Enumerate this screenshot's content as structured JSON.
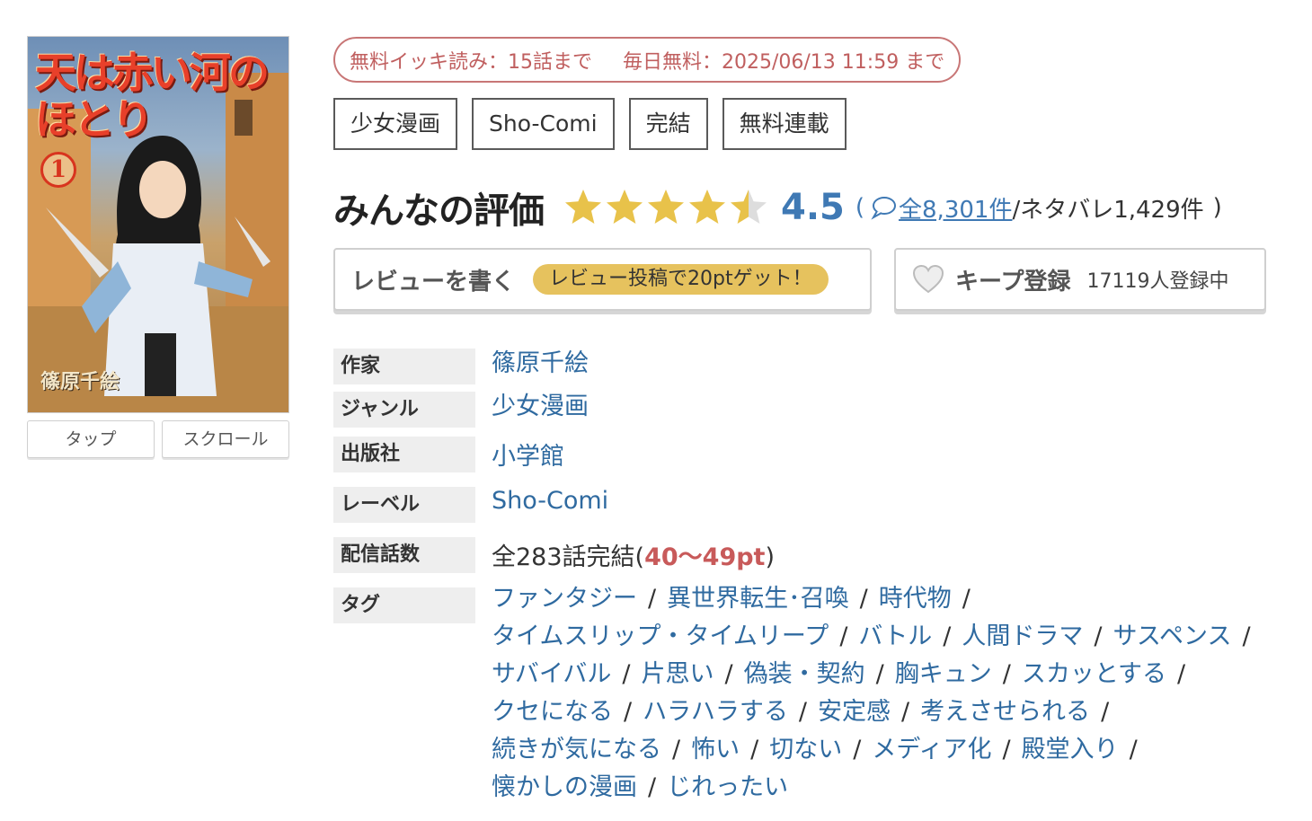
{
  "cover": {
    "title_line1": "天は赤い河の",
    "title_line2": "ほとり",
    "volume": "1",
    "author": "篠原千絵",
    "buttons": [
      "タップ",
      "スクロール"
    ]
  },
  "promo": {
    "free_read": "無料イッキ読み：15話まで",
    "daily_free": "毎日無料：2025/06/13 11:59 まで"
  },
  "genre_tags": [
    "少女漫画",
    "Sho-Comi",
    "完結",
    "無料連載"
  ],
  "rating": {
    "label": "みんなの評価",
    "score": "4.5",
    "stars_value": 4.5,
    "stars_max": 5,
    "open_paren": "(",
    "reviews_link": "全8,301件",
    "spoiler_text": "/ネタバレ1,429件",
    "close_paren": ")"
  },
  "actions": {
    "write_review": "レビューを書く",
    "review_bonus": "レビュー投稿で20ptゲット！",
    "keep": "キープ登録",
    "keep_count": "17119人登録中"
  },
  "info": {
    "author_label": "作家",
    "author_value": "篠原千絵",
    "genre_label": "ジャンル",
    "genre_value": "少女漫画",
    "publisher_label": "出版社",
    "publisher_value": "小学館",
    "label_label": "レーベル",
    "label_value": "Sho-Comi",
    "episodes_label": "配信話数",
    "episodes_value": "全283話完結(",
    "episodes_price": "40〜49pt",
    "episodes_close": ")",
    "tags_label": "タグ"
  },
  "tags": [
    [
      "ファンタジー",
      "異世界転生･召喚",
      "時代物"
    ],
    [
      "タイムスリップ・タイムリープ",
      "バトル",
      "人間ドラマ",
      "サスペンス"
    ],
    [
      "サバイバル",
      "片思い",
      "偽装・契約",
      "胸キュン",
      "スカッとする"
    ],
    [
      "クセになる",
      "ハラハラする",
      "安定感",
      "考えさせられる"
    ],
    [
      "続きが気になる",
      "怖い",
      "切ない",
      "メディア化",
      "殿堂入り"
    ],
    [
      "懐かしの漫画",
      "じれったい"
    ]
  ],
  "colors": {
    "star": "#e8c24a",
    "star_empty": "#dddddd",
    "link": "#3f79b4",
    "promo": "#c05f5f",
    "badge": "#e6c25e"
  }
}
